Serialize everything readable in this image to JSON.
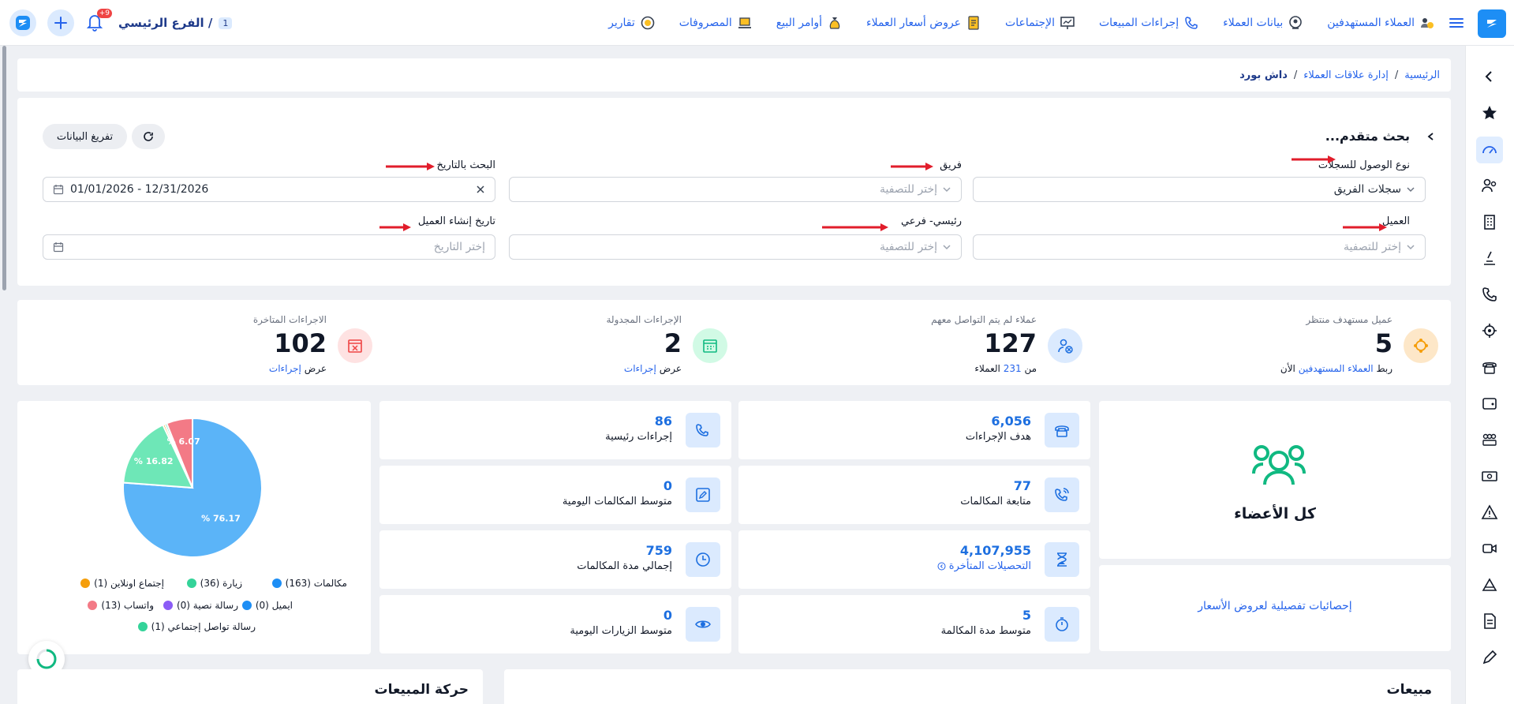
{
  "topbar": {
    "nav": [
      {
        "label": "العملاء المستهدفين",
        "icon": "target-customers-icon"
      },
      {
        "label": "بيانات العملاء",
        "icon": "customer-data-icon"
      },
      {
        "label": "إجراءات المبيعات",
        "icon": "phone-icon"
      },
      {
        "label": "الإجتماعات",
        "icon": "presentation-icon"
      },
      {
        "label": "عروض أسعار العملاء",
        "icon": "quote-icon"
      },
      {
        "label": "أوامر البيع",
        "icon": "money-bag-icon"
      },
      {
        "label": "المصروفات",
        "icon": "laptop-icon"
      },
      {
        "label": "تقارير",
        "icon": "reports-icon"
      }
    ],
    "branch_name": "الفرع الرئيسي /",
    "branch_count": "1",
    "notification_count": "+9"
  },
  "breadcrumb": {
    "home": "الرئيسية",
    "section": "إدارة علاقات العملاء",
    "current": "داش بورد",
    "sep": "/"
  },
  "filters": {
    "title": "بحث متقدم...",
    "clear_label": "تفريغ البيانات",
    "access_label": "نوع الوصول للسجلات",
    "access_value": "سجلات الفريق",
    "team_label": "فريق",
    "team_placeholder": "إختر للتصفية",
    "date_label": "البحث بالتاريخ",
    "date_value": "01/01/2026 - 12/31/2026",
    "customer_label": "العميل",
    "customer_placeholder": "إختر للتصفية",
    "branch_label": "رئيسي- فرعي",
    "branch_placeholder": "إختر للتصفية",
    "created_label": "تاريخ إنشاء العميل",
    "created_placeholder": "إختر التاريخ"
  },
  "kpis": [
    {
      "title": "عميل مستهدف منتظر",
      "value": "5",
      "sub_prefix": "ربط",
      "sub_link": "العملاء المستهدفين",
      "sub_suffix": "الأن",
      "color": "#fde7c8"
    },
    {
      "title": "عملاء لم يتم التواصل معهم",
      "value": "127",
      "sub_prefix": "من",
      "sub_link": "231",
      "sub_suffix": "العملاء",
      "color": "#dbeafe"
    },
    {
      "title": "الإجراءات المجدولة",
      "value": "2",
      "sub_prefix": "عرض",
      "sub_link": "إجراءات",
      "sub_suffix": "",
      "color": "#d1fae5"
    },
    {
      "title": "الاجراءات المتاخرة",
      "value": "102",
      "sub_prefix": "عرض",
      "sub_link": "إجراءات",
      "sub_suffix": "",
      "color": "#fee2e2"
    }
  ],
  "members": {
    "label": "كل الأعضاء",
    "quotes_link": "إحصائيات تفصيلية لعروض الأسعار"
  },
  "stats_col1": [
    {
      "value": "6,056",
      "label": "هدف الإجراءات",
      "icon": "desk-phone-icon"
    },
    {
      "value": "77",
      "label": "متابعة المكالمات",
      "icon": "phone-ringing-icon"
    },
    {
      "value": "4,107,955",
      "label": "التحصيلات المتأخرة",
      "icon": "hourglass-icon"
    },
    {
      "value": "5",
      "label": "متوسط مدة المكالمة",
      "icon": "stopwatch-icon"
    }
  ],
  "stats_col2": [
    {
      "value": "86",
      "label": "إجراءات رئيسية",
      "icon": "phone-icon"
    },
    {
      "value": "0",
      "label": "متوسط المكالمات اليومية",
      "icon": "phone-edit-icon"
    },
    {
      "value": "759",
      "label": "إجمالي مدة المكالمات",
      "icon": "clock-icon"
    },
    {
      "value": "0",
      "label": "متوسط الزيارات اليومية",
      "icon": "eye-icon"
    }
  ],
  "chart_data": {
    "type": "pie",
    "slice_labels": [
      "76.17 %",
      "16.82 %",
      "6.07 %"
    ],
    "slices": [
      {
        "name": "مكالمات",
        "count": 163,
        "percent": 76.17,
        "color": "#5bb4f8"
      },
      {
        "name": "زيارة",
        "count": 36,
        "percent": 16.82,
        "color": "#6ee7b7"
      },
      {
        "name": "إجتماع اونلاين",
        "count": 1,
        "percent": 0.47,
        "color": "#f59e0b"
      },
      {
        "name": "ايميل",
        "count": 0,
        "percent": 0,
        "color": "#1d8ef5"
      },
      {
        "name": "رسالة نصية",
        "count": 0,
        "percent": 0,
        "color": "#8b5cf6"
      },
      {
        "name": "واتساب",
        "count": 13,
        "percent": 6.07,
        "color": "#f37a86"
      },
      {
        "name": "رسالة تواصل إجتماعي",
        "count": 1,
        "percent": 0.47,
        "color": "#34d399"
      }
    ],
    "legend": [
      "مكالمات (163)",
      "زيارة (36)",
      "إجتماع اونلاين (1)",
      "ايميل (0)",
      "رسالة نصية (0)",
      "واتساب (13)",
      "رسالة تواصل إجتماعي (1)"
    ]
  },
  "sections": {
    "sales": "مبيعات",
    "sales_movement": "حركة المبيعات"
  }
}
